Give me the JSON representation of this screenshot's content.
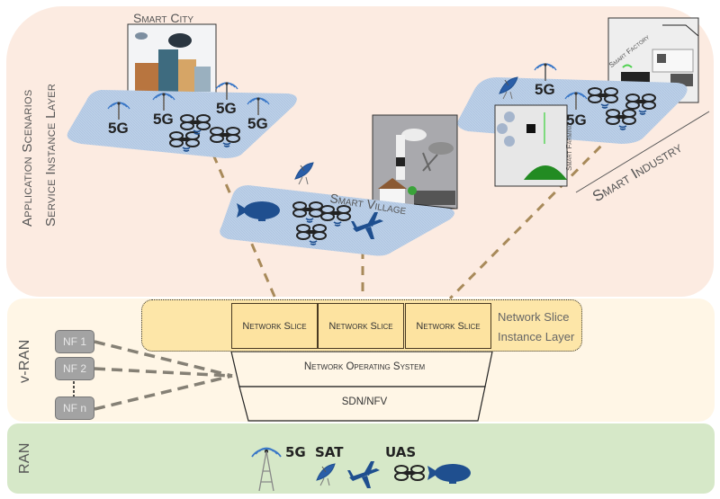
{
  "layers": {
    "application": {
      "label_line1": "Application Scenarios",
      "label_line2": "Service Instance Layer"
    },
    "vran": {
      "label": "v-RAN"
    },
    "ran": {
      "label": "RAN"
    }
  },
  "scenarios": {
    "smart_city": {
      "label": "Smart City",
      "fiveg_labels": [
        "5G",
        "5G",
        "5G",
        "5G"
      ]
    },
    "smart_village": {
      "label": "Smart Village"
    },
    "smart_industry": {
      "label": "Smart Industry",
      "fiveg_labels": [
        "5G",
        "5G"
      ]
    },
    "smart_farming": {
      "label": "Smart Farming"
    },
    "smart_factory": {
      "label": "Smart Factory"
    }
  },
  "slice_layer": {
    "slices": [
      "Network Slice",
      "Network Slice",
      "Network Slice"
    ],
    "label_line1": "Network Slice",
    "label_line2": "Instance Layer"
  },
  "core": {
    "os_label": "Network Operating System",
    "sdn_label": "SDN/NFV"
  },
  "network_functions": [
    "NF 1",
    "NF 2",
    "NF n"
  ],
  "ran_items": {
    "fiveg": "5G",
    "sat": "SAT",
    "uas": "UAS"
  },
  "colors": {
    "application_band": "#fcebe1",
    "vran_band": "#fff6e6",
    "ran_band": "#d6e8c8",
    "slice_fill": "#fde3a0",
    "platform": "#b8cde6",
    "connector": "#a88a5a",
    "icon_blue": "#1f4f8f"
  }
}
